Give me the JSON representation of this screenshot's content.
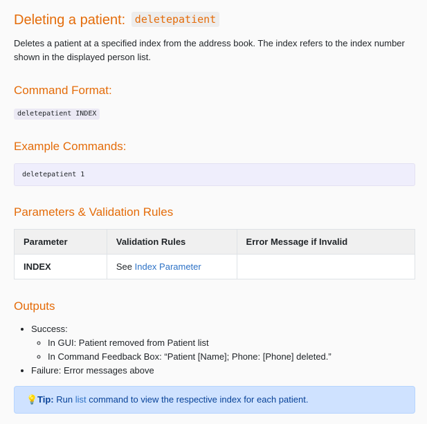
{
  "header": {
    "title_prefix": "Deleting a patient:",
    "title_code": "deletepatient"
  },
  "description": "Deletes a patient at a specified index from the address book. The index refers to the index number shown in the displayed person list.",
  "command_format": {
    "heading": "Command Format:",
    "code": "deletepatient INDEX"
  },
  "example_commands": {
    "heading": "Example Commands:",
    "code": "deletepatient 1"
  },
  "parameters": {
    "heading": "Parameters & Validation Rules",
    "columns": [
      "Parameter",
      "Validation Rules",
      "Error Message if Invalid"
    ],
    "rows": [
      {
        "parameter": "INDEX",
        "rule_prefix": "See",
        "rule_link": "Index Parameter",
        "error_message": ""
      }
    ]
  },
  "outputs": {
    "heading": "Outputs",
    "success_label": "Success:",
    "success_items": [
      "In GUI: Patient removed from Patient list",
      "In Command Feedback Box: “Patient [Name]; Phone: [Phone] deleted.”"
    ],
    "failure_label": "Failure: Error messages above"
  },
  "tip": {
    "icon": "lightbulb-icon",
    "label": "Tip:",
    "text_before": "Run",
    "link": "list",
    "text_after": "command to view the respective index for each patient."
  },
  "colors": {
    "heading": "#e46c0a",
    "link": "#2d72c6",
    "tip_background": "#cfe2ff",
    "example_background": "#efeefc"
  }
}
